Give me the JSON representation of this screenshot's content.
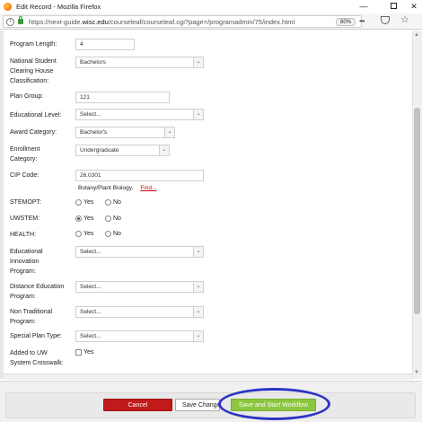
{
  "window": {
    "title": "Edit Record - Mozilla Firefox",
    "minimize": "—",
    "close": "✕"
  },
  "urlbar": {
    "url_prefix": "https://next-guide.",
    "url_domain": "wisc.edu",
    "url_suffix": "/courseleaf/courseleaf.cgi?page=/programadmin/75/index.html",
    "zoom": "80%",
    "more_icon": "•••",
    "star_icon": "☆"
  },
  "form": {
    "program_length": {
      "label": "Program Length:",
      "value": "4"
    },
    "nsc_classification": {
      "label": "National Student Clearing House Classification:",
      "value": "Bachelors"
    },
    "plan_group": {
      "label": "Plan Group:",
      "value": "121"
    },
    "educational_level": {
      "label": "Educational Level:",
      "value": "Select..."
    },
    "award_category": {
      "label": "Award Category:",
      "value": "Bachelor's"
    },
    "enrollment_category": {
      "label": "Enrollment Category:",
      "value": "Undergraduate"
    },
    "cip_code": {
      "label": "CIP Code:",
      "value": "26.0301",
      "description": "Botany/Plant Biology.",
      "find_link": "Find..."
    },
    "stemopt": {
      "label": "STEMOPT:",
      "yes": "Yes",
      "no": "No",
      "selected": "none"
    },
    "uwstem": {
      "label": "UWSTEM:",
      "yes": "Yes",
      "no": "No",
      "selected": "yes"
    },
    "health": {
      "label": "HEALTH:",
      "yes": "Yes",
      "no": "No",
      "selected": "none"
    },
    "educational_innovation": {
      "label": "Educational Innovation Program:",
      "value": "Select..."
    },
    "distance_education": {
      "label": "Distance Education Program:",
      "value": "Select..."
    },
    "non_traditional": {
      "label": "Non Traditional Program:",
      "value": "Select..."
    },
    "special_plan_type": {
      "label": "Special Plan Type:",
      "value": "Select..."
    },
    "uw_system_crosswalk": {
      "label": "Added to UW System Crosswalk:",
      "checkbox_label": "Yes",
      "checked": false
    }
  },
  "footer": {
    "cancel_label": "Cancel",
    "save_changes_label": "Save Changes",
    "save_workflow_label": "Save and Start Workflow"
  },
  "colors": {
    "cancel": "#c01a1a",
    "workflow": "#8cc63f",
    "highlight": "#2c35c2",
    "link": "#c5050c"
  }
}
